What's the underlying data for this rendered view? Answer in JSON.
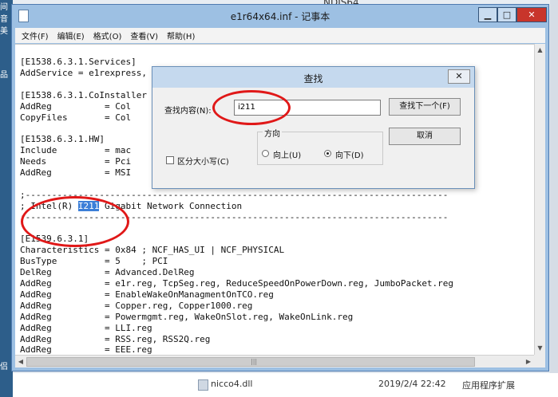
{
  "background": {
    "top_title": "NDIS64",
    "left_labels": [
      "间音美",
      "品",
      "侣"
    ],
    "bottom_file_name": "nicco4.dll",
    "bottom_date": "2019/2/4 22:42",
    "bottom_type": "应用程序扩展"
  },
  "window": {
    "title": "e1r64x64.inf - 记事本",
    "min_icon": "minimize-icon",
    "max_icon": "maximize-icon",
    "close_icon": "close-icon"
  },
  "menu": [
    "文件(F)",
    "编辑(E)",
    "格式(O)",
    "查看(V)",
    "帮助(H)"
  ],
  "editor_lines": [
    "[E1538.6.3.1.Services]",
    "AddService = e1rexpress,",
    "",
    "[E1538.6.3.1.CoInstaller",
    "AddReg          = Col",
    "CopyFiles       = Col",
    "",
    "[E1538.6.3.1.HW]",
    "Include         = mac",
    "Needs           = Pci",
    "AddReg          = MSI",
    "",
    ";--------------------------------------------------------------------------------",
    "",
    ";--------------------------------------------------------------------------------",
    "",
    "[E1539.6.3.1]",
    "Characteristics = 0x84 ; NCF_HAS_UI | NCF_PHYSICAL",
    "BusType         = 5    ; PCI",
    "DelReg          = Advanced.DelReg",
    "AddReg          = e1r.reg, TcpSeg.reg, ReduceSpeedOnPowerDown.reg, JumboPacket.reg",
    "AddReg          = EnableWakeOnManagmentOnTCO.reg",
    "AddReg          = Copper.reg, Copper1000.reg",
    "AddReg          = Powermgmt.reg, WakeOnSlot.reg, WakeOnLink.reg",
    "AddReg          = LLI.reg",
    "AddReg          = RSS.reg, RSS2Q.reg",
    "AddReg          = EEE.reg"
  ],
  "highlight_line": {
    "prefix": "; Intel(R) ",
    "match": "I211",
    "suffix": " Gigabit Network Connection"
  },
  "find_dialog": {
    "title": "查找",
    "find_label": "查找内容(N):",
    "find_value": "i211",
    "find_next_label": "查找下一个(F)",
    "cancel_label": "取消",
    "direction_label": "方向",
    "up_label": "向上(U)",
    "down_label": "向下(D)",
    "selected_direction": "down",
    "match_case_label": "区分大小写(C)",
    "match_case_checked": false
  },
  "annotation_color": "#e01818"
}
